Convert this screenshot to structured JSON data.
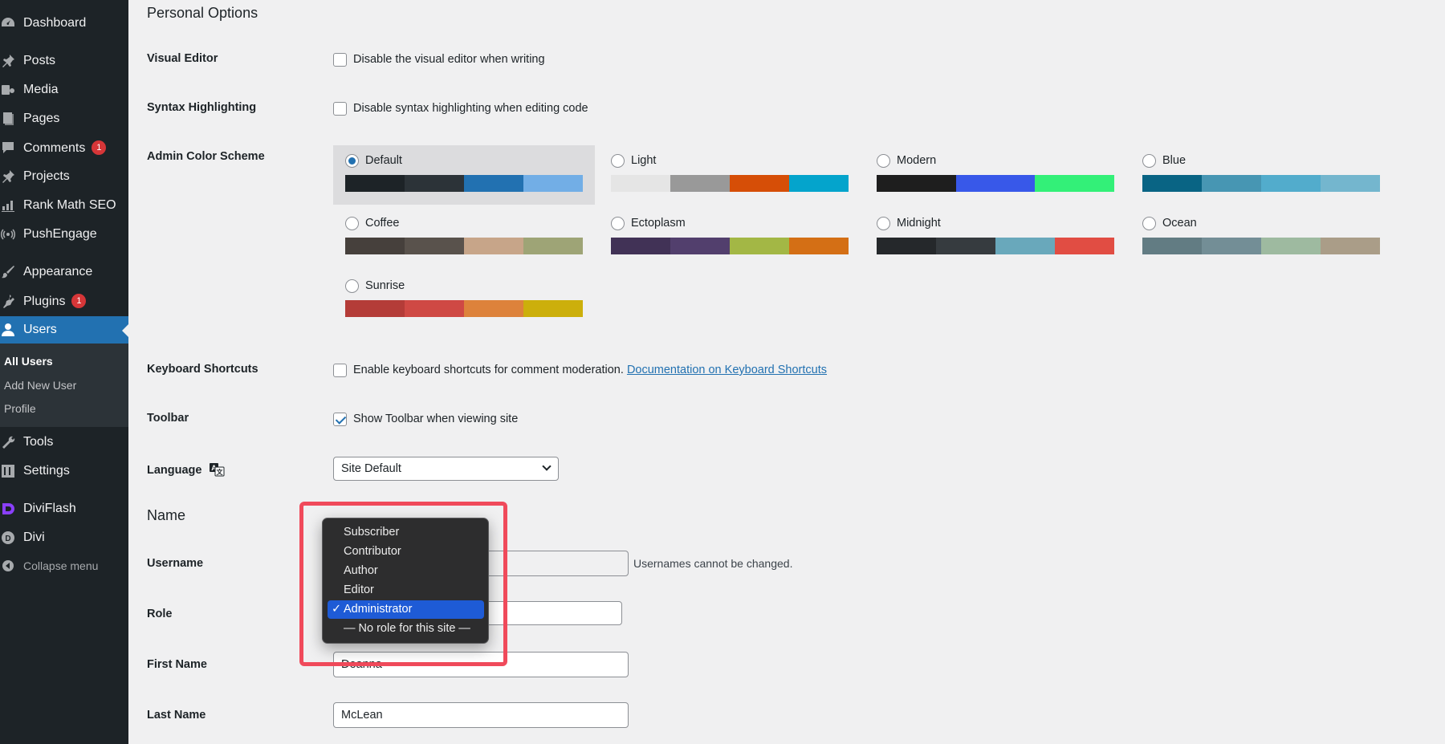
{
  "sidebar": {
    "items": [
      {
        "label": "Dashboard",
        "icon": "dashboard-icon"
      },
      {
        "label": "Posts",
        "icon": "pin-icon"
      },
      {
        "label": "Media",
        "icon": "media-icon"
      },
      {
        "label": "Pages",
        "icon": "pages-icon"
      },
      {
        "label": "Comments",
        "icon": "comments-icon",
        "badge": "1"
      },
      {
        "label": "Projects",
        "icon": "pin-icon"
      },
      {
        "label": "Rank Math SEO",
        "icon": "chart-icon"
      },
      {
        "label": "PushEngage",
        "icon": "broadcast-icon"
      },
      {
        "label": "Appearance",
        "icon": "brush-icon"
      },
      {
        "label": "Plugins",
        "icon": "plugin-icon",
        "badge": "1"
      },
      {
        "label": "Users",
        "icon": "user-icon",
        "active": true
      },
      {
        "label": "Tools",
        "icon": "wrench-icon"
      },
      {
        "label": "Settings",
        "icon": "settings-icon"
      },
      {
        "label": "DiviFlash",
        "icon": "diviflash-icon"
      },
      {
        "label": "Divi",
        "icon": "divi-icon"
      },
      {
        "label": "Collapse menu",
        "icon": "collapse-icon"
      }
    ],
    "submenu": [
      "All Users",
      "Add New User",
      "Profile"
    ]
  },
  "main": {
    "personal_options_title": "Personal Options",
    "visual_editor": {
      "label": "Visual Editor",
      "checkbox_label": "Disable the visual editor when writing",
      "checked": false
    },
    "syntax_highlighting": {
      "label": "Syntax Highlighting",
      "checkbox_label": "Disable syntax highlighting when editing code",
      "checked": false
    },
    "admin_color_scheme": {
      "label": "Admin Color Scheme",
      "selected": "Default",
      "schemes": [
        {
          "name": "Default",
          "colors": [
            "#1d2327",
            "#2c3338",
            "#2271b1",
            "#72aee6"
          ]
        },
        {
          "name": "Light",
          "colors": [
            "#e5e5e5",
            "#999999",
            "#d64e07",
            "#04a4cc"
          ]
        },
        {
          "name": "Modern",
          "colors": [
            "#1e1e1e",
            "#3858e9",
            "#33f078"
          ]
        },
        {
          "name": "Blue",
          "colors": [
            "#096484",
            "#4796b3",
            "#52accc",
            "#74b6ce"
          ]
        },
        {
          "name": "Coffee",
          "colors": [
            "#46403c",
            "#59524c",
            "#c7a589",
            "#9ea476"
          ]
        },
        {
          "name": "Ectoplasm",
          "colors": [
            "#413256",
            "#523f6d",
            "#a3b745",
            "#d46f15"
          ]
        },
        {
          "name": "Midnight",
          "colors": [
            "#25282b",
            "#363b3f",
            "#69a8bb",
            "#e14d43"
          ]
        },
        {
          "name": "Ocean",
          "colors": [
            "#627c83",
            "#738e96",
            "#9ebaa0",
            "#aa9d88"
          ]
        },
        {
          "name": "Sunrise",
          "colors": [
            "#b43c38",
            "#cf4944",
            "#dd823b",
            "#ccaf0b"
          ]
        }
      ]
    },
    "keyboard_shortcuts": {
      "label": "Keyboard Shortcuts",
      "checkbox_label": "Enable keyboard shortcuts for comment moderation.",
      "link": "Documentation on Keyboard Shortcuts",
      "checked": false
    },
    "toolbar": {
      "label": "Toolbar",
      "checkbox_label": "Show Toolbar when viewing site",
      "checked": true
    },
    "language": {
      "label": "Language",
      "value": "Site Default"
    },
    "name_title": "Name",
    "username": {
      "label": "Username",
      "description": "Usernames cannot be changed."
    },
    "role": {
      "label": "Role",
      "options": [
        "Subscriber",
        "Contributor",
        "Author",
        "Editor",
        "Administrator",
        "— No role for this site —"
      ],
      "selected": "Administrator"
    },
    "first_name": {
      "label": "First Name",
      "value": "Deanna"
    },
    "last_name": {
      "label": "Last Name",
      "value": "McLean"
    }
  }
}
